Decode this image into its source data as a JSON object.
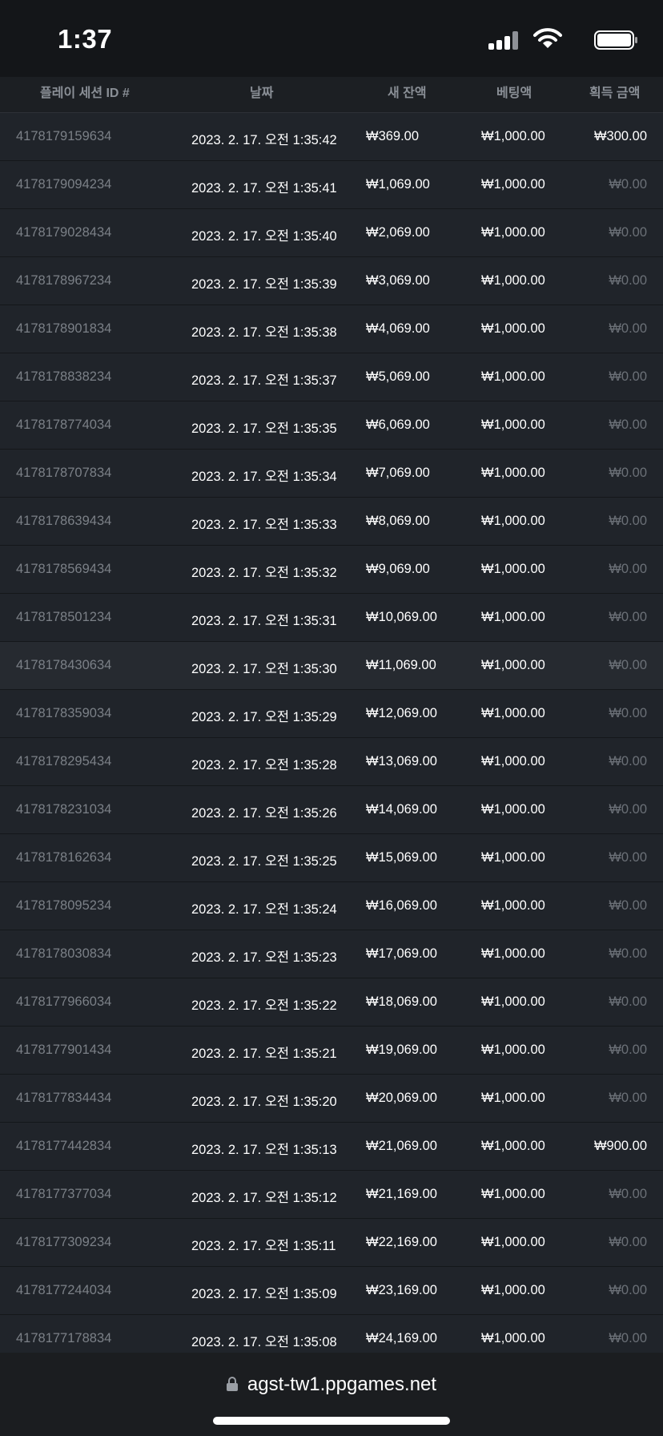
{
  "status_bar": {
    "time": "1:37"
  },
  "table": {
    "headers": {
      "session_id": "플레이 세션 ID #",
      "date": "날짜",
      "new_balance": "새 잔액",
      "bet": "베팅액",
      "win": "획득 금액"
    },
    "rows": [
      {
        "id": "4178179159634",
        "date": "2023. 2. 17. 오전 1:35:42",
        "balance": "₩369.00",
        "bet": "₩1,000.00",
        "win": "₩300.00"
      },
      {
        "id": "4178179094234",
        "date": "2023. 2. 17. 오전 1:35:41",
        "balance": "₩1,069.00",
        "bet": "₩1,000.00",
        "win": "₩0.00"
      },
      {
        "id": "4178179028434",
        "date": "2023. 2. 17. 오전 1:35:40",
        "balance": "₩2,069.00",
        "bet": "₩1,000.00",
        "win": "₩0.00"
      },
      {
        "id": "4178178967234",
        "date": "2023. 2. 17. 오전 1:35:39",
        "balance": "₩3,069.00",
        "bet": "₩1,000.00",
        "win": "₩0.00"
      },
      {
        "id": "4178178901834",
        "date": "2023. 2. 17. 오전 1:35:38",
        "balance": "₩4,069.00",
        "bet": "₩1,000.00",
        "win": "₩0.00"
      },
      {
        "id": "4178178838234",
        "date": "2023. 2. 17. 오전 1:35:37",
        "balance": "₩5,069.00",
        "bet": "₩1,000.00",
        "win": "₩0.00"
      },
      {
        "id": "4178178774034",
        "date": "2023. 2. 17. 오전 1:35:35",
        "balance": "₩6,069.00",
        "bet": "₩1,000.00",
        "win": "₩0.00"
      },
      {
        "id": "4178178707834",
        "date": "2023. 2. 17. 오전 1:35:34",
        "balance": "₩7,069.00",
        "bet": "₩1,000.00",
        "win": "₩0.00"
      },
      {
        "id": "4178178639434",
        "date": "2023. 2. 17. 오전 1:35:33",
        "balance": "₩8,069.00",
        "bet": "₩1,000.00",
        "win": "₩0.00"
      },
      {
        "id": "4178178569434",
        "date": "2023. 2. 17. 오전 1:35:32",
        "balance": "₩9,069.00",
        "bet": "₩1,000.00",
        "win": "₩0.00"
      },
      {
        "id": "4178178501234",
        "date": "2023. 2. 17. 오전 1:35:31",
        "balance": "₩10,069.00",
        "bet": "₩1,000.00",
        "win": "₩0.00"
      },
      {
        "id": "4178178430634",
        "date": "2023. 2. 17. 오전 1:35:30",
        "balance": "₩11,069.00",
        "bet": "₩1,000.00",
        "win": "₩0.00"
      },
      {
        "id": "4178178359034",
        "date": "2023. 2. 17. 오전 1:35:29",
        "balance": "₩12,069.00",
        "bet": "₩1,000.00",
        "win": "₩0.00"
      },
      {
        "id": "4178178295434",
        "date": "2023. 2. 17. 오전 1:35:28",
        "balance": "₩13,069.00",
        "bet": "₩1,000.00",
        "win": "₩0.00"
      },
      {
        "id": "4178178231034",
        "date": "2023. 2. 17. 오전 1:35:26",
        "balance": "₩14,069.00",
        "bet": "₩1,000.00",
        "win": "₩0.00"
      },
      {
        "id": "4178178162634",
        "date": "2023. 2. 17. 오전 1:35:25",
        "balance": "₩15,069.00",
        "bet": "₩1,000.00",
        "win": "₩0.00"
      },
      {
        "id": "4178178095234",
        "date": "2023. 2. 17. 오전 1:35:24",
        "balance": "₩16,069.00",
        "bet": "₩1,000.00",
        "win": "₩0.00"
      },
      {
        "id": "4178178030834",
        "date": "2023. 2. 17. 오전 1:35:23",
        "balance": "₩17,069.00",
        "bet": "₩1,000.00",
        "win": "₩0.00"
      },
      {
        "id": "4178177966034",
        "date": "2023. 2. 17. 오전 1:35:22",
        "balance": "₩18,069.00",
        "bet": "₩1,000.00",
        "win": "₩0.00"
      },
      {
        "id": "4178177901434",
        "date": "2023. 2. 17. 오전 1:35:21",
        "balance": "₩19,069.00",
        "bet": "₩1,000.00",
        "win": "₩0.00"
      },
      {
        "id": "4178177834434",
        "date": "2023. 2. 17. 오전 1:35:20",
        "balance": "₩20,069.00",
        "bet": "₩1,000.00",
        "win": "₩0.00"
      },
      {
        "id": "4178177442834",
        "date": "2023. 2. 17. 오전 1:35:13",
        "balance": "₩21,069.00",
        "bet": "₩1,000.00",
        "win": "₩900.00"
      },
      {
        "id": "4178177377034",
        "date": "2023. 2. 17. 오전 1:35:12",
        "balance": "₩21,169.00",
        "bet": "₩1,000.00",
        "win": "₩0.00"
      },
      {
        "id": "4178177309234",
        "date": "2023. 2. 17. 오전 1:35:11",
        "balance": "₩22,169.00",
        "bet": "₩1,000.00",
        "win": "₩0.00"
      },
      {
        "id": "4178177244034",
        "date": "2023. 2. 17. 오전 1:35:09",
        "balance": "₩23,169.00",
        "bet": "₩1,000.00",
        "win": "₩0.00"
      },
      {
        "id": "4178177178834",
        "date": "2023. 2. 17. 오전 1:35:08",
        "balance": "₩24,169.00",
        "bet": "₩1,000.00",
        "win": "₩0.00"
      }
    ]
  },
  "browser": {
    "url": "agst-tw1.ppgames.net"
  },
  "colors": {
    "background": "#1c1f23",
    "status_bar": "#141619",
    "muted_text": "#7b8087",
    "zero_win_text": "#6b7077"
  }
}
